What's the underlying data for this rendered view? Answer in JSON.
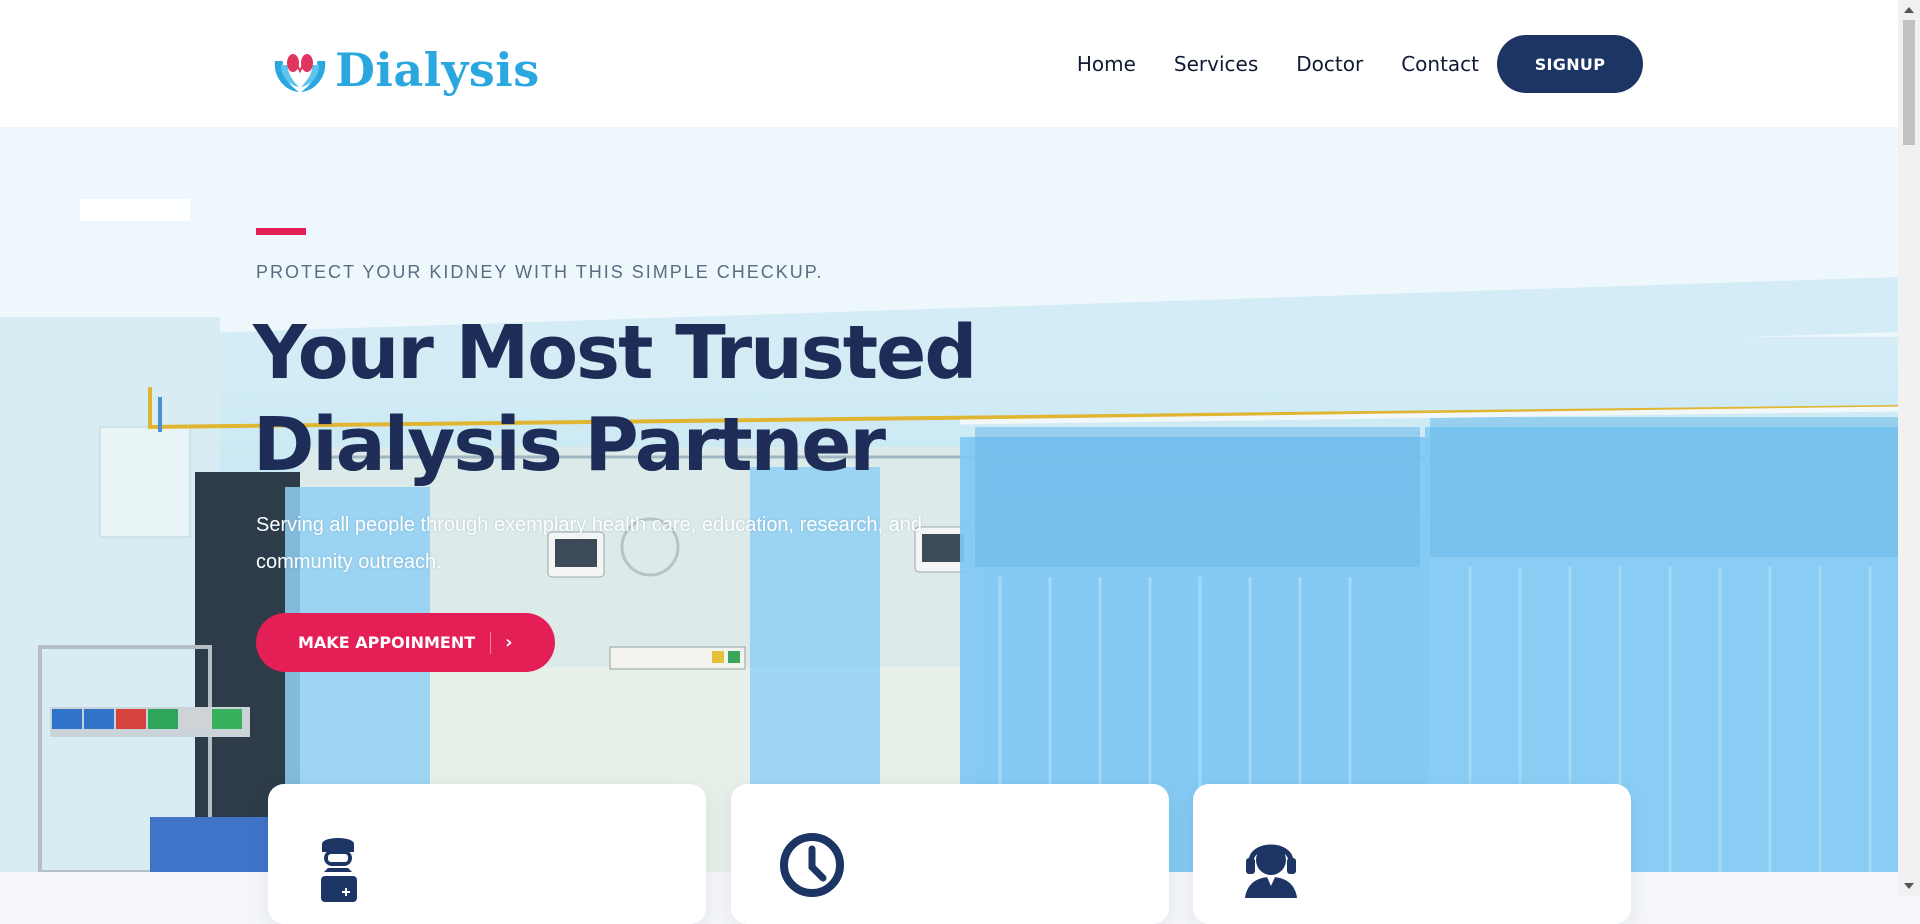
{
  "brand": {
    "name": "Dialysis",
    "logo_icon": "hands-kidney-icon",
    "color": "#2aa7de"
  },
  "nav": {
    "items": [
      {
        "label": "Home"
      },
      {
        "label": "Services"
      },
      {
        "label": "Doctor"
      },
      {
        "label": "Contact"
      }
    ],
    "signup_label": "SIGNUP"
  },
  "hero": {
    "eyebrow": "PROTECT YOUR KIDNEY WITH THIS SIMPLE CHECKUP.",
    "headline_line1": "Your Most Trusted",
    "headline_line2": "Dialysis Partner",
    "subtext": "Serving all people through exemplary health care, education, research, and community outreach.",
    "cta_label": "MAKE APPOINMENT",
    "cta_icon": "chevron-right-icon",
    "background": "hospital-dialysis-ward-photo"
  },
  "cards": [
    {
      "icon": "doctor-briefcase-icon"
    },
    {
      "icon": "clock-icon"
    },
    {
      "icon": "support-headset-icon"
    }
  ],
  "colors": {
    "primary": "#1c3565",
    "accent": "#e31f55",
    "headline": "#1d2d58"
  }
}
